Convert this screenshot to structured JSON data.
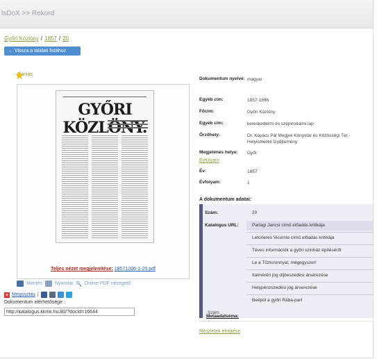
{
  "window": {
    "title": "lsDoX >> Rekord"
  },
  "breadcrumb": {
    "items": [
      "Győri Közlöny",
      "1857",
      "20"
    ],
    "separator": "/"
  },
  "back_button": {
    "label": "← Vissza a találati listához"
  },
  "recommend": {
    "label": "Ajánlás"
  },
  "preview": {
    "masthead": "GYŐRI KÖZLÖNY.",
    "full_view_label": "Teljes nézet megjelenítése:",
    "full_view_file": "18571206-1-20.pdf"
  },
  "tools": {
    "send_label": "Mentés",
    "print_label": "Nyomtat",
    "pdf_label": "Online PDF nézegető"
  },
  "share": {
    "label": "Megosztás"
  },
  "access": {
    "label": "Dokumentum elérhetősége :",
    "url": "http://katalogus.kkmk.hu:80/?docId=16644"
  },
  "metadata": [
    {
      "label": "Dokumentum nyelve:",
      "value": "magyar"
    },
    {
      "label": "Egyéb cím:",
      "value": "1857-1896"
    },
    {
      "label": "Főcím:",
      "value": "Győri Közlöny"
    },
    {
      "label": "Egyéb cím:",
      "value": "kereskedelmi és szépirodalmi lap"
    },
    {
      "label": "Őrzőhely:",
      "value": "Dr. Kovács Pál Megyei Könyvtár és Közösségi Tér - Helyismereti Gyűjtemény"
    },
    {
      "label": "Megjelenés helye:",
      "value": "Győr"
    }
  ],
  "evfolyam": {
    "section_label": "Évfolyam",
    "rows": [
      {
        "label": "Év:",
        "value": "1857"
      },
      {
        "label": "Évfolyam:",
        "value": "1"
      }
    ]
  },
  "doc_data": {
    "title": "A dokumentum adatai:",
    "szam_label": "Szám:",
    "szam_value": "20",
    "catalog_label": "Katalógus URL:",
    "catalog_items": [
      "Parlagi Jancsi című előadás kritikája",
      "Letorieres Vicomte című előadás kritikája",
      "Téves információk a győri színház építéséről",
      "Le a Tűztoronnyal, mégegyszer!",
      "Italméréri jog díjbeszedési árverezése",
      "Helypénzszedési jog árverezése",
      "Beépül a győri Rába-part"
    ],
    "metadataset_label": "Metaadatséma:",
    "metadataset_value": "Szám"
  },
  "details_link": {
    "label": "Részletek elrejtése"
  },
  "colors": {
    "accent_green": "#8e9b3a",
    "button_blue": "#4f8fd1",
    "link_red": "#b3261e",
    "panel_bar": "#575785"
  }
}
